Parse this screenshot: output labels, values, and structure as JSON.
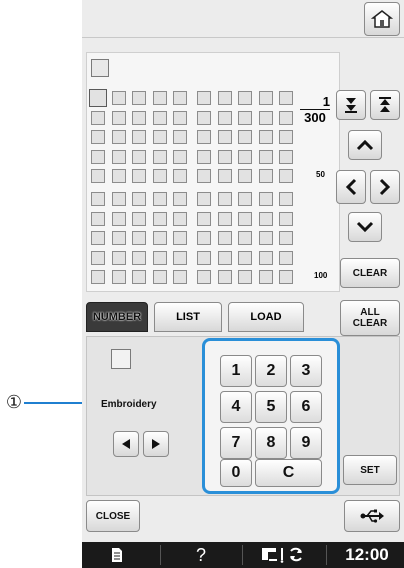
{
  "callout": {
    "number": "①"
  },
  "grid": {
    "fraction_top": "1",
    "fraction_bottom": "300",
    "row_label_mid": "50",
    "row_label_end": "100"
  },
  "buttons": {
    "clear": "CLEAR",
    "all_clear_line1": "ALL",
    "all_clear_line2": "CLEAR",
    "set": "SET",
    "close": "CLOSE"
  },
  "tabs": {
    "number": "NUMBER",
    "list": "LIST",
    "load": "LOAD"
  },
  "label": {
    "embroidery": "Embroidery"
  },
  "keypad": [
    "1",
    "2",
    "3",
    "4",
    "5",
    "6",
    "7",
    "8",
    "9",
    "0",
    "C"
  ],
  "status": {
    "help": "?",
    "clock": "12:00"
  },
  "colors": {
    "keypad_border": "#2a8fd8",
    "status_bg": "#1a1a1a",
    "active_tab": "#3a3a3a"
  }
}
